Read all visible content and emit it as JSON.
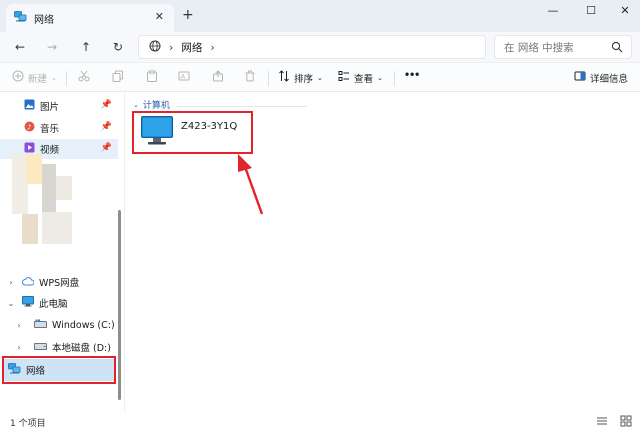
{
  "window": {
    "tab_title": "网络",
    "tab_close": "✕",
    "new_tab": "+",
    "minimize": "—",
    "maximize": "☐",
    "close": "✕"
  },
  "nav": {
    "back": "←",
    "forward": "→",
    "up": "↑",
    "refresh": "↻"
  },
  "address": {
    "segments": [
      "网络"
    ],
    "separator": "›"
  },
  "search": {
    "placeholder": "在 网络 中搜索"
  },
  "commands": {
    "new_label": "新建",
    "sort_label": "排序",
    "view_label": "查看",
    "more_label": "•••",
    "details_label": "详细信息"
  },
  "sidebar": {
    "quick_access": [
      {
        "label": "图片",
        "icon": "pictures-icon"
      },
      {
        "label": "音乐",
        "icon": "music-icon"
      },
      {
        "label": "视频",
        "icon": "videos-icon"
      }
    ],
    "tree": [
      {
        "label": "WPS网盘",
        "icon": "cloud-drive-icon",
        "expanded": false
      },
      {
        "label": "此电脑",
        "icon": "this-pc-icon",
        "expanded": true
      },
      {
        "label": "Windows (C:)",
        "icon": "windows-drive-icon",
        "expanded": false
      },
      {
        "label": "本地磁盘 (D:)",
        "icon": "local-disk-icon",
        "expanded": false
      },
      {
        "label": "网络",
        "icon": "network-icon",
        "selected": true
      }
    ]
  },
  "content": {
    "group_label": "计算机",
    "computers": [
      {
        "name": "Z423-3Y1Q"
      }
    ]
  },
  "status": {
    "item_count": "1 个项目"
  },
  "colors": {
    "accent": "#0067c0",
    "highlight": "#e3232b",
    "selected_bg": "#cfe3f7"
  }
}
